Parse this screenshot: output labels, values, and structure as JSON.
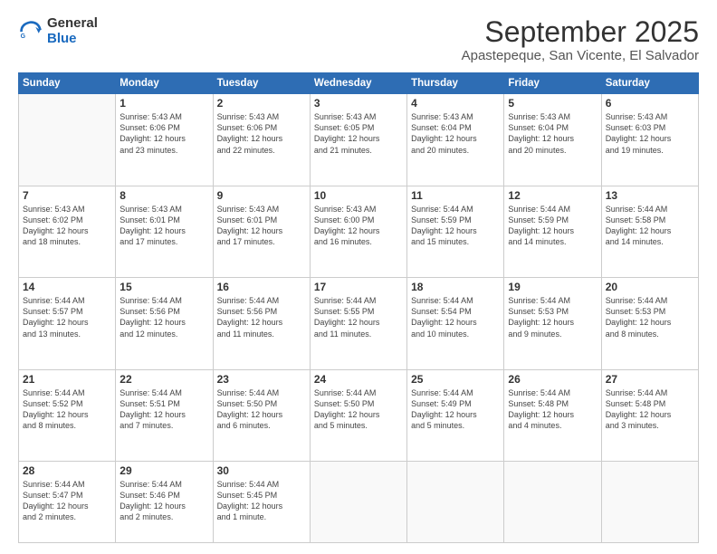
{
  "header": {
    "logo_line1": "General",
    "logo_line2": "Blue",
    "month": "September 2025",
    "location": "Apastepeque, San Vicente, El Salvador"
  },
  "days": [
    "Sunday",
    "Monday",
    "Tuesday",
    "Wednesday",
    "Thursday",
    "Friday",
    "Saturday"
  ],
  "weeks": [
    [
      {
        "num": "",
        "lines": []
      },
      {
        "num": "1",
        "lines": [
          "Sunrise: 5:43 AM",
          "Sunset: 6:06 PM",
          "Daylight: 12 hours",
          "and 23 minutes."
        ]
      },
      {
        "num": "2",
        "lines": [
          "Sunrise: 5:43 AM",
          "Sunset: 6:06 PM",
          "Daylight: 12 hours",
          "and 22 minutes."
        ]
      },
      {
        "num": "3",
        "lines": [
          "Sunrise: 5:43 AM",
          "Sunset: 6:05 PM",
          "Daylight: 12 hours",
          "and 21 minutes."
        ]
      },
      {
        "num": "4",
        "lines": [
          "Sunrise: 5:43 AM",
          "Sunset: 6:04 PM",
          "Daylight: 12 hours",
          "and 20 minutes."
        ]
      },
      {
        "num": "5",
        "lines": [
          "Sunrise: 5:43 AM",
          "Sunset: 6:04 PM",
          "Daylight: 12 hours",
          "and 20 minutes."
        ]
      },
      {
        "num": "6",
        "lines": [
          "Sunrise: 5:43 AM",
          "Sunset: 6:03 PM",
          "Daylight: 12 hours",
          "and 19 minutes."
        ]
      }
    ],
    [
      {
        "num": "7",
        "lines": [
          "Sunrise: 5:43 AM",
          "Sunset: 6:02 PM",
          "Daylight: 12 hours",
          "and 18 minutes."
        ]
      },
      {
        "num": "8",
        "lines": [
          "Sunrise: 5:43 AM",
          "Sunset: 6:01 PM",
          "Daylight: 12 hours",
          "and 17 minutes."
        ]
      },
      {
        "num": "9",
        "lines": [
          "Sunrise: 5:43 AM",
          "Sunset: 6:01 PM",
          "Daylight: 12 hours",
          "and 17 minutes."
        ]
      },
      {
        "num": "10",
        "lines": [
          "Sunrise: 5:43 AM",
          "Sunset: 6:00 PM",
          "Daylight: 12 hours",
          "and 16 minutes."
        ]
      },
      {
        "num": "11",
        "lines": [
          "Sunrise: 5:44 AM",
          "Sunset: 5:59 PM",
          "Daylight: 12 hours",
          "and 15 minutes."
        ]
      },
      {
        "num": "12",
        "lines": [
          "Sunrise: 5:44 AM",
          "Sunset: 5:59 PM",
          "Daylight: 12 hours",
          "and 14 minutes."
        ]
      },
      {
        "num": "13",
        "lines": [
          "Sunrise: 5:44 AM",
          "Sunset: 5:58 PM",
          "Daylight: 12 hours",
          "and 14 minutes."
        ]
      }
    ],
    [
      {
        "num": "14",
        "lines": [
          "Sunrise: 5:44 AM",
          "Sunset: 5:57 PM",
          "Daylight: 12 hours",
          "and 13 minutes."
        ]
      },
      {
        "num": "15",
        "lines": [
          "Sunrise: 5:44 AM",
          "Sunset: 5:56 PM",
          "Daylight: 12 hours",
          "and 12 minutes."
        ]
      },
      {
        "num": "16",
        "lines": [
          "Sunrise: 5:44 AM",
          "Sunset: 5:56 PM",
          "Daylight: 12 hours",
          "and 11 minutes."
        ]
      },
      {
        "num": "17",
        "lines": [
          "Sunrise: 5:44 AM",
          "Sunset: 5:55 PM",
          "Daylight: 12 hours",
          "and 11 minutes."
        ]
      },
      {
        "num": "18",
        "lines": [
          "Sunrise: 5:44 AM",
          "Sunset: 5:54 PM",
          "Daylight: 12 hours",
          "and 10 minutes."
        ]
      },
      {
        "num": "19",
        "lines": [
          "Sunrise: 5:44 AM",
          "Sunset: 5:53 PM",
          "Daylight: 12 hours",
          "and 9 minutes."
        ]
      },
      {
        "num": "20",
        "lines": [
          "Sunrise: 5:44 AM",
          "Sunset: 5:53 PM",
          "Daylight: 12 hours",
          "and 8 minutes."
        ]
      }
    ],
    [
      {
        "num": "21",
        "lines": [
          "Sunrise: 5:44 AM",
          "Sunset: 5:52 PM",
          "Daylight: 12 hours",
          "and 8 minutes."
        ]
      },
      {
        "num": "22",
        "lines": [
          "Sunrise: 5:44 AM",
          "Sunset: 5:51 PM",
          "Daylight: 12 hours",
          "and 7 minutes."
        ]
      },
      {
        "num": "23",
        "lines": [
          "Sunrise: 5:44 AM",
          "Sunset: 5:50 PM",
          "Daylight: 12 hours",
          "and 6 minutes."
        ]
      },
      {
        "num": "24",
        "lines": [
          "Sunrise: 5:44 AM",
          "Sunset: 5:50 PM",
          "Daylight: 12 hours",
          "and 5 minutes."
        ]
      },
      {
        "num": "25",
        "lines": [
          "Sunrise: 5:44 AM",
          "Sunset: 5:49 PM",
          "Daylight: 12 hours",
          "and 5 minutes."
        ]
      },
      {
        "num": "26",
        "lines": [
          "Sunrise: 5:44 AM",
          "Sunset: 5:48 PM",
          "Daylight: 12 hours",
          "and 4 minutes."
        ]
      },
      {
        "num": "27",
        "lines": [
          "Sunrise: 5:44 AM",
          "Sunset: 5:48 PM",
          "Daylight: 12 hours",
          "and 3 minutes."
        ]
      }
    ],
    [
      {
        "num": "28",
        "lines": [
          "Sunrise: 5:44 AM",
          "Sunset: 5:47 PM",
          "Daylight: 12 hours",
          "and 2 minutes."
        ]
      },
      {
        "num": "29",
        "lines": [
          "Sunrise: 5:44 AM",
          "Sunset: 5:46 PM",
          "Daylight: 12 hours",
          "and 2 minutes."
        ]
      },
      {
        "num": "30",
        "lines": [
          "Sunrise: 5:44 AM",
          "Sunset: 5:45 PM",
          "Daylight: 12 hours",
          "and 1 minute."
        ]
      },
      {
        "num": "",
        "lines": []
      },
      {
        "num": "",
        "lines": []
      },
      {
        "num": "",
        "lines": []
      },
      {
        "num": "",
        "lines": []
      }
    ]
  ]
}
